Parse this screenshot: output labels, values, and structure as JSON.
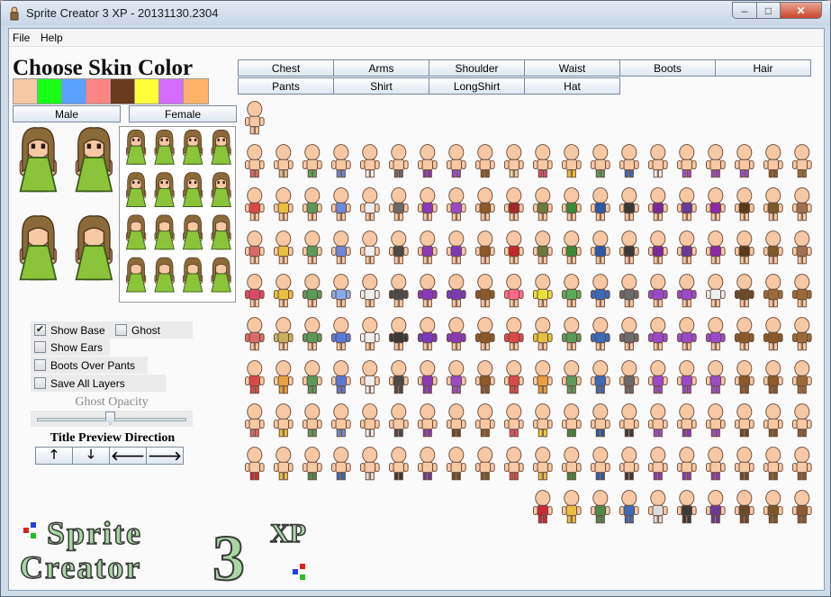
{
  "window": {
    "title": "Sprite Creator 3 XP - 20131130.2304",
    "minimize": "–",
    "maximize": "□",
    "close": "✕"
  },
  "menu": {
    "file": "File",
    "help": "Help"
  },
  "skin": {
    "title": "Choose Skin Color",
    "swatches": [
      "#f7c8a4",
      "#18ff18",
      "#5aa0ff",
      "#ff8484",
      "#6a3a1c",
      "#ffff3a",
      "#d66cff",
      "#ffb26a"
    ]
  },
  "gender": {
    "male": "Male",
    "female": "Female"
  },
  "tabs": {
    "row1": [
      "Chest",
      "Arms",
      "Shoulder",
      "Waist",
      "Boots",
      "Hair"
    ],
    "row2": [
      "Pants",
      "Shirt",
      "LongShirt",
      "Hat"
    ]
  },
  "options": {
    "show_base": "Show Base",
    "ghost": "Ghost",
    "show_ears": "Show Ears",
    "boots_over_pants": "Boots Over Pants",
    "save_all_layers": "Save All Layers",
    "show_base_checked": "✔"
  },
  "ghost_opacity": {
    "label": "Ghost Opacity",
    "value": 0.5
  },
  "preview_direction": {
    "title": "Title Preview Direction",
    "up": "🡑",
    "down": "🡓",
    "left": "🡐",
    "right": "🡒"
  },
  "logo": {
    "line1": "Sprite",
    "line2": "Creator",
    "number": "3",
    "suffix": "XP"
  },
  "colors": {
    "hair": "#8b6a3a",
    "dress": "#8bc43a",
    "skin": "#f7c8a4",
    "logo_green": "#a9d6a5"
  },
  "sprite_grid": {
    "rows": [
      {
        "count": 1
      },
      {
        "count": 20,
        "colors": [
          "#d86a6a",
          "#d8c08a",
          "#5aa85a",
          "#6a8ad8",
          "#f0f0f0",
          "#6a6a6a",
          "#8a3ab8",
          "#9a4ac8",
          "#8a5a2a",
          "#e8d0a0",
          "#d84a6a",
          "#e8c040",
          "#5a9a5a",
          "#3a6ab8",
          "#eeeeee",
          "#a04ac8",
          "#9a4ac8",
          "#9a4ac8",
          "#8a5a2a",
          "#9a6a3a"
        ]
      },
      {
        "count": 20,
        "colors": [
          "#d84a4a",
          "#e8c040",
          "#5a9a5a",
          "#6a8ad8",
          "#eeeeee",
          "#6a6a6a",
          "#8a3ab8",
          "#9a4ac8",
          "#8a5a2a",
          "#a02a2a",
          "#6a7a3a",
          "#3a8a3a",
          "#2a5aa8",
          "#3a3a3a",
          "#7a2a98",
          "#6a3a98",
          "#8a2aa8",
          "#5a3a1a",
          "#7a5a2a",
          "#a07050"
        ]
      },
      {
        "count": 20,
        "colors": [
          "#d86a6a",
          "#e8c040",
          "#5a9a5a",
          "#6a8ad8",
          "#eeeeee",
          "#4a4a4a",
          "#8a3ab8",
          "#7a3ab8",
          "#8a5a2a",
          "#c02a2a",
          "#6a7a3a",
          "#3a8a3a",
          "#2a5aa8",
          "#3a3a3a",
          "#7a2a98",
          "#6a3a98",
          "#8a2aa8",
          "#5a3a1a",
          "#7a5a2a",
          "#a07050"
        ]
      },
      {
        "count": 20,
        "colors": [
          "#d84a6a",
          "#e8c040",
          "#5a9a5a",
          "#8aaae8",
          "#eeeeee",
          "#4a4a4a",
          "#8a3ab8",
          "#7a3ab8",
          "#8a5a2a",
          "#ff6a8a",
          "#e8e040",
          "#5aaa5a",
          "#3a6ab8",
          "#6a6a6a",
          "#9a4ac8",
          "#9a4ac8",
          "#eeeeee",
          "#6a4a2a",
          "#9a6a3a",
          "#9a6a3a"
        ]
      },
      {
        "count": 20,
        "colors": [
          "#d86a6a",
          "#c8b060",
          "#5a9a5a",
          "#5a7ad8",
          "#eeeeee",
          "#3a3a3a",
          "#7a3ab8",
          "#8a3ab8",
          "#8a5a2a",
          "#d84a4a",
          "#e8c040",
          "#5a9a5a",
          "#3a6ab8",
          "#6a6a6a",
          "#9a4ac8",
          "#9a4ac8",
          "#9a4ac8",
          "#8a5a2a",
          "#8a5a2a",
          "#9a6a3a"
        ]
      },
      {
        "count": 20,
        "colors": [
          "#d84a4a",
          "#e8a040",
          "#5a9a5a",
          "#5a7ad8",
          "#eeeeee",
          "#4a4a4a",
          "#8a3ab8",
          "#9a4ac8",
          "#8a5a2a",
          "#d84a4a",
          "#e8a040",
          "#5a9a5a",
          "#3a6ab8",
          "#6a6a6a",
          "#9a4ac8",
          "#9a4ac8",
          "#9a4ac8",
          "#8a5a2a",
          "#8a5a2a",
          "#9a6a3a"
        ]
      },
      {
        "count": 20,
        "colors": [
          "#d86a6a",
          "#e8c040",
          "#5a9a5a",
          "#6a8ad8",
          "#eeeeee",
          "#4a4a4a",
          "#8a3ab8",
          "#6a4a2a",
          "#8a5a2a",
          "#e84a6a",
          "#e8d040",
          "#3a8a3a",
          "#2a5aa8",
          "#3a3a3a",
          "#9a4ac8",
          "#8a3ab8",
          "#9a4ac8",
          "#6a4a2a",
          "#7a5a2a",
          "#8a5a3a"
        ]
      },
      {
        "count": 20,
        "colors": [
          "#c82a3a",
          "#e8c040",
          "#4a8a4a",
          "#3a6ab8",
          "#dddddd",
          "#3a3a3a",
          "#6a3a9a",
          "#6a4a2a",
          "#7a5a2a",
          "#d84a4a",
          "#e8c040",
          "#3a8a3a",
          "#2a5aa8",
          "#3a3a3a",
          "#8a3ab8",
          "#8a3ab8",
          "#8a3ab8",
          "#6a4a2a",
          "#7a5a2a",
          "#8a5a3a"
        ]
      },
      {
        "count": 10,
        "offset": 10,
        "colors": [
          "#c82a3a",
          "#e8c040",
          "#4a8a4a",
          "#3a6ab8",
          "#dddddd",
          "#3a3a3a",
          "#6a3a9a",
          "#6a4a2a",
          "#7a5a2a",
          "#8a5a3a"
        ]
      }
    ]
  }
}
